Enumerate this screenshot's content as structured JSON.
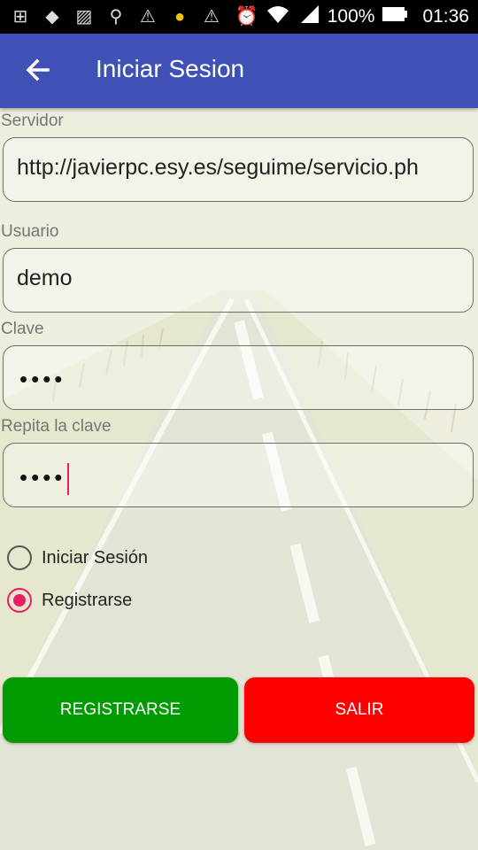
{
  "status_bar": {
    "battery": "100%",
    "time": "01:36",
    "icons": [
      "add-box-icon",
      "cat-icon",
      "image-icon",
      "search-icon",
      "warning-icon",
      "bulb-icon",
      "warning-icon",
      "alarm-icon",
      "wifi-icon",
      "signal-icon",
      "battery-icon"
    ]
  },
  "toolbar": {
    "title": "Iniciar Sesion"
  },
  "form": {
    "server_label": "Servidor",
    "server_value": "http://javierpc.esy.es/seguime/servicio.ph",
    "user_label": "Usuario",
    "user_value": "demo",
    "password_label": "Clave",
    "password_mask": "••••",
    "repeat_label": "Repita la clave",
    "repeat_mask": "••••"
  },
  "options": {
    "login_label": "Iniciar Sesión",
    "register_label": "Registrarse",
    "selected": "register"
  },
  "buttons": {
    "register_label": "REGISTRARSE",
    "register_color": "#009b00",
    "exit_label": "SALIR",
    "exit_color": "#ff0000"
  },
  "colors": {
    "toolbar": "#3f51b5",
    "accent": "#e91e63"
  }
}
